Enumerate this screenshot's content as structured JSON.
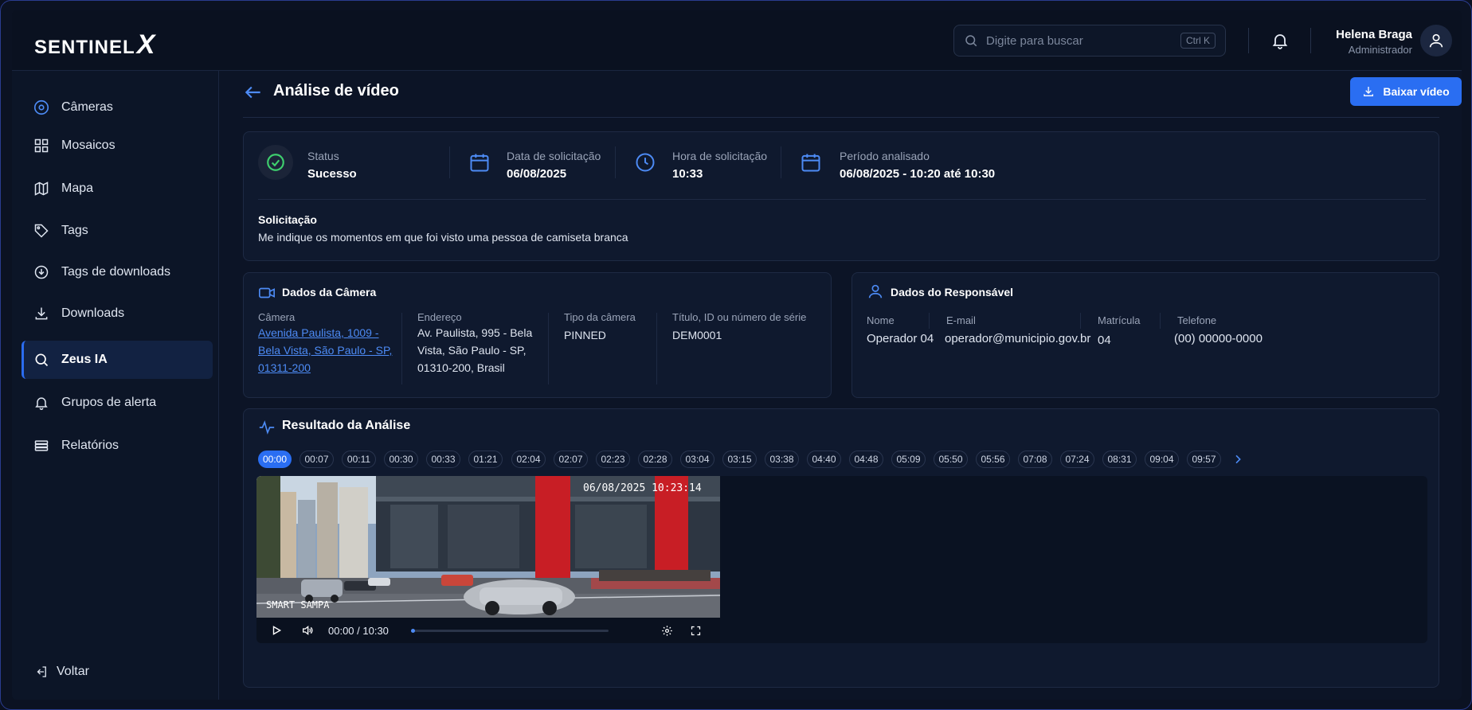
{
  "header": {
    "logo_text": "SENTINEL",
    "logo_mark": "X",
    "search_placeholder": "Digite para buscar",
    "search_shortcut": "Ctrl K",
    "user_name": "Helena Braga",
    "user_role": "Administrador"
  },
  "sidebar": {
    "items": [
      {
        "label": "Câmeras",
        "icon": "camera-icon"
      },
      {
        "label": "Mosaicos",
        "icon": "grid-icon"
      },
      {
        "label": "Mapa",
        "icon": "map-icon"
      },
      {
        "label": "Tags",
        "icon": "tag-icon"
      },
      {
        "label": "Tags de downloads",
        "icon": "download-tag-icon"
      },
      {
        "label": "Downloads",
        "icon": "download-icon"
      },
      {
        "label": "Zeus IA",
        "icon": "search-icon",
        "active": true
      },
      {
        "label": "Grupos de alerta",
        "icon": "bell-icon"
      },
      {
        "label": "Relatórios",
        "icon": "report-icon"
      }
    ],
    "back_label": "Voltar"
  },
  "page": {
    "title": "Análise de vídeo",
    "download_label": "Baixar vídeo"
  },
  "summary": {
    "status_label": "Status",
    "status_value": "Sucesso",
    "date_label": "Data de solicitação",
    "date_value": "06/08/2025",
    "time_label": "Hora de solicitação",
    "time_value": "10:33",
    "period_label": "Período analisado",
    "period_value": "06/08/2025 - 10:20 até 10:30",
    "request_label": "Solicitação",
    "request_value": "Me indique os momentos em que foi visto uma pessoa de camiseta branca"
  },
  "camera": {
    "title": "Dados da Câmera",
    "camera_label": "Câmera",
    "camera_line1": "Avenida Paulista, 1009 -",
    "camera_line2": "Bela Vista, São Paulo - SP,",
    "camera_line3": "01311-200",
    "address_label": "Endereço",
    "address_line1": "Av. Paulista, 995 - Bela",
    "address_line2": "Vista, São Paulo - SP,",
    "address_line3": "01310-200, Brasil",
    "type_label": "Tipo da câmera",
    "type_value": "PINNED",
    "serial_label": "Título, ID ou número de série",
    "serial_value": "DEM0001"
  },
  "responsible": {
    "title": "Dados do Responsável",
    "name_label": "Nome",
    "name_value": "Operador 04",
    "email_label": "E-mail",
    "email_value": "operador@municipio.gov.br",
    "reg_label": "Matrícula",
    "reg_value": "04",
    "phone_label": "Telefone",
    "phone_value": "(00) 00000-0000"
  },
  "result": {
    "title": "Resultado da Análise",
    "timestamps": [
      "00:00",
      "00:07",
      "00:11",
      "00:30",
      "00:33",
      "01:21",
      "02:04",
      "02:07",
      "02:23",
      "02:28",
      "03:04",
      "03:15",
      "03:38",
      "04:40",
      "04:48",
      "05:09",
      "05:50",
      "05:56",
      "07:08",
      "07:24",
      "08:31",
      "09:04",
      "09:57"
    ],
    "video_overlay_time": "06/08/2025 10:23:14",
    "video_watermark": "SMART SAMPA",
    "player_time": "00:00 / 10:30",
    "progress": 0.0
  }
}
